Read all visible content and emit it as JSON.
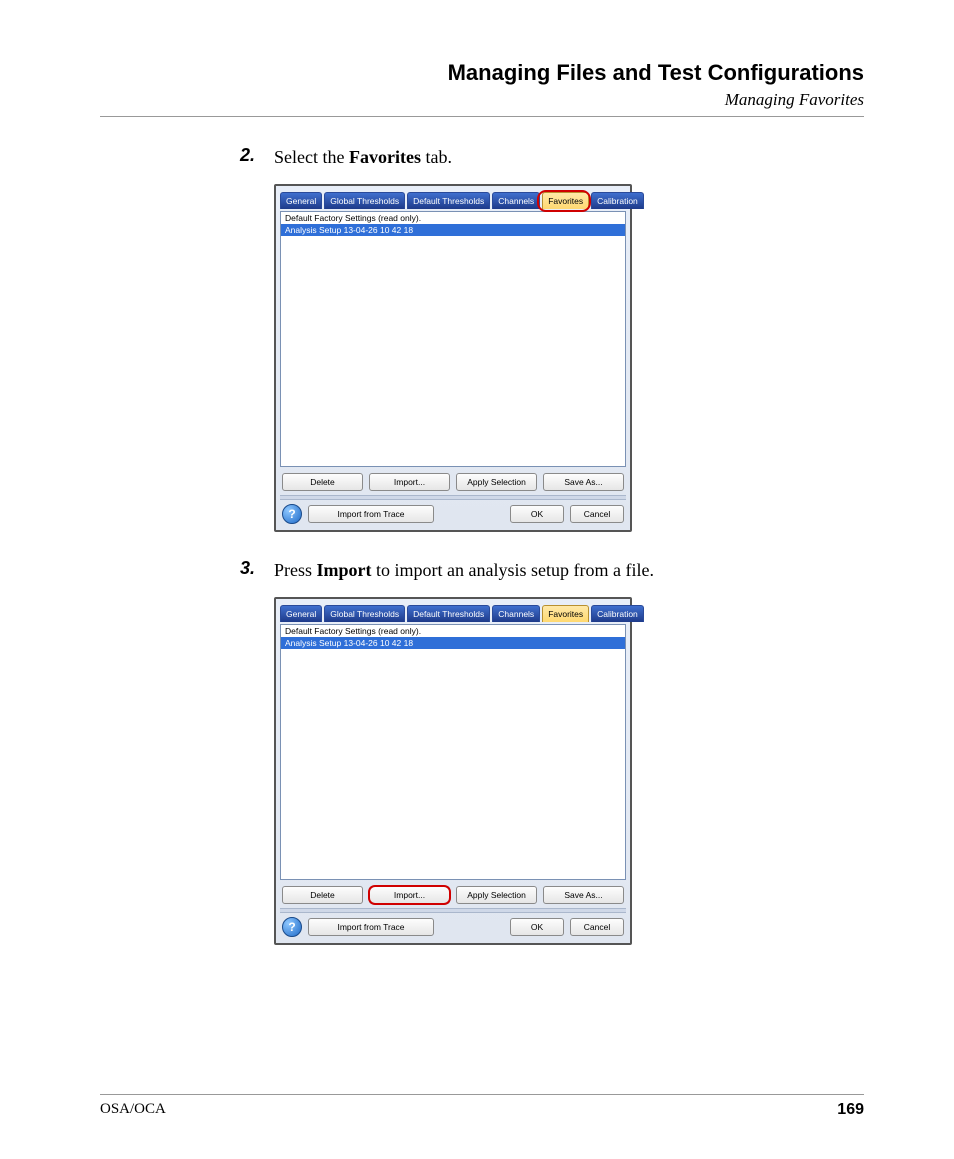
{
  "header": {
    "title": "Managing Files and Test Configurations",
    "subtitle": "Managing Favorites"
  },
  "steps": {
    "s2_num": "2.",
    "s2_pre": "Select the ",
    "s2_bold": "Favorites",
    "s2_post": " tab.",
    "s3_num": "3.",
    "s3_pre": "Press ",
    "s3_bold": "Import",
    "s3_post": " to import an analysis setup from a file."
  },
  "dialog": {
    "tabs": {
      "general": "General",
      "global": "Global Thresholds",
      "default": "Default Thresholds",
      "channels": "Channels",
      "favorites": "Favorites",
      "calibration": "Calibration"
    },
    "list": {
      "item0": "Default Factory Settings (read only).",
      "item1": "Analysis Setup 13-04-26 10 42 18"
    },
    "buttons": {
      "delete": "Delete",
      "import": "Import...",
      "apply": "Apply Selection",
      "saveas": "Save As...",
      "import_trace": "Import from Trace",
      "ok": "OK",
      "cancel": "Cancel"
    },
    "help_glyph": "?"
  },
  "footer": {
    "left": "OSA/OCA",
    "page": "169"
  }
}
